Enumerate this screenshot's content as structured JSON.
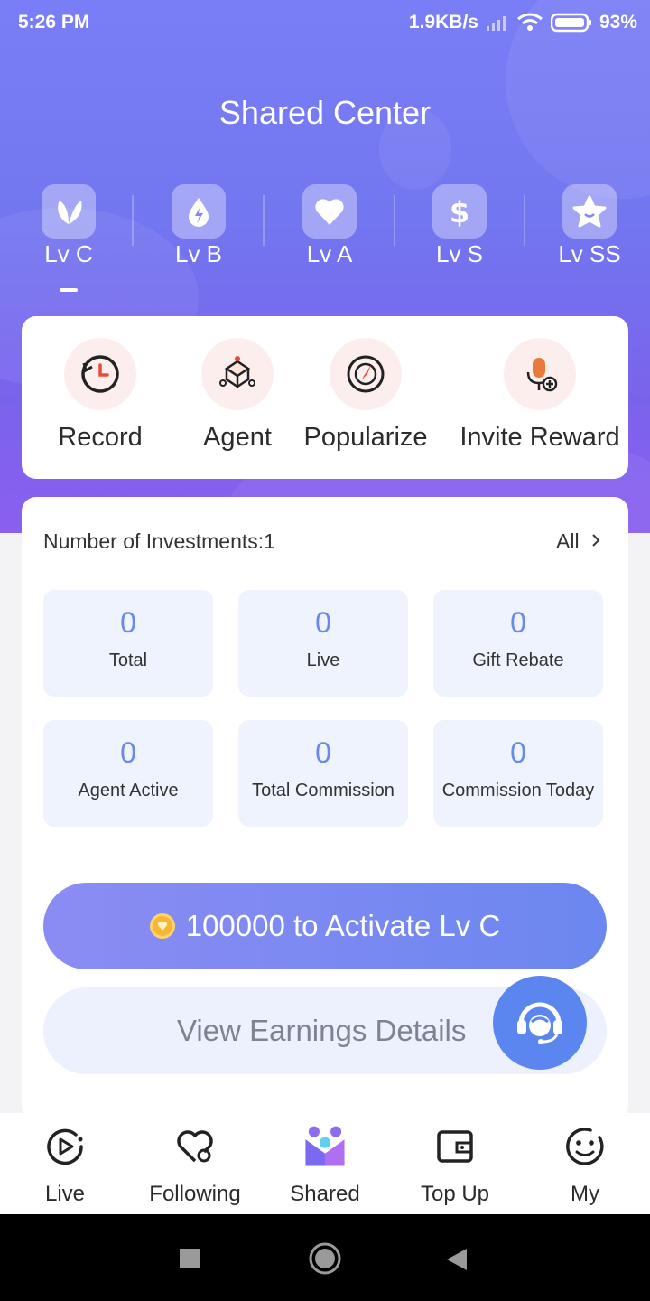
{
  "status": {
    "time": "5:26 PM",
    "speed": "1.9KB/s",
    "battery": "93%"
  },
  "header": {
    "title": "Shared Center"
  },
  "levels": [
    {
      "label": "Lv C",
      "icon": "leaf-icon",
      "active": true
    },
    {
      "label": "Lv B",
      "icon": "drop-icon",
      "active": false
    },
    {
      "label": "Lv A",
      "icon": "heart-icon",
      "active": false
    },
    {
      "label": "Lv S",
      "icon": "dollar-icon",
      "active": false
    },
    {
      "label": "Lv SS",
      "icon": "star-icon",
      "active": false
    }
  ],
  "quick_actions": [
    {
      "label": "Record",
      "icon": "clock-icon"
    },
    {
      "label": "Agent",
      "icon": "agent-icon"
    },
    {
      "label": "Popularize",
      "icon": "target-icon"
    },
    {
      "label": "Invite Reward",
      "icon": "microphone-add-icon"
    }
  ],
  "investments": {
    "title": "Number of Investments:1",
    "all_label": "All",
    "stats": [
      {
        "value": "0",
        "label": "Total"
      },
      {
        "value": "0",
        "label": "Live"
      },
      {
        "value": "0",
        "label": "Gift Rebate"
      },
      {
        "value": "0",
        "label": "Agent Active"
      },
      {
        "value": "0",
        "label": "Total Commission"
      },
      {
        "value": "0",
        "label": "Commission Today"
      }
    ]
  },
  "actions": {
    "activate_label": "100000 to Activate Lv C",
    "earnings_label": "View Earnings Details"
  },
  "tabbar": [
    {
      "label": "Live",
      "icon": "play-icon"
    },
    {
      "label": "Following",
      "icon": "heart-outline-icon"
    },
    {
      "label": "Shared",
      "icon": "shared-icon",
      "active": true
    },
    {
      "label": "Top Up",
      "icon": "wallet-icon"
    },
    {
      "label": "My",
      "icon": "smile-icon"
    }
  ],
  "colors": {
    "accent": "#7a7ef6",
    "stat_value": "#6a8ae8",
    "stat_bg": "#eef3fd",
    "support": "#5b86ef"
  }
}
